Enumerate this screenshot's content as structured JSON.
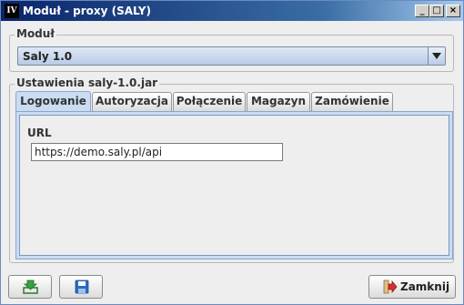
{
  "window": {
    "title": "Moduł - proxy (SALY)",
    "app_icon_text": "IV",
    "minimize_glyph": "_",
    "maximize_glyph": "□",
    "close_glyph": "×"
  },
  "module_group": {
    "label": "Moduł",
    "selected": "Saly 1.0"
  },
  "settings_group": {
    "label": "Ustawienia saly-1.0.jar"
  },
  "tabs": [
    {
      "label": "Logowanie",
      "active": true
    },
    {
      "label": "Autoryzacja",
      "active": false
    },
    {
      "label": "Połączenie",
      "active": false
    },
    {
      "label": "Magazyn",
      "active": false
    },
    {
      "label": "Zamówienie",
      "active": false
    }
  ],
  "login_tab": {
    "url_label": "URL",
    "url_value": "https://demo.saly.pl/api"
  },
  "footer": {
    "import_icon": "download-icon",
    "save_icon": "save-icon",
    "close_label": "Zamknij",
    "close_icon": "exit-icon"
  },
  "colors": {
    "title_bar": "#0a246a",
    "accent_tab": "#c9dcf2",
    "download_green": "#3aa040",
    "save_blue": "#2a6cc0",
    "exit_red": "#d83030"
  }
}
